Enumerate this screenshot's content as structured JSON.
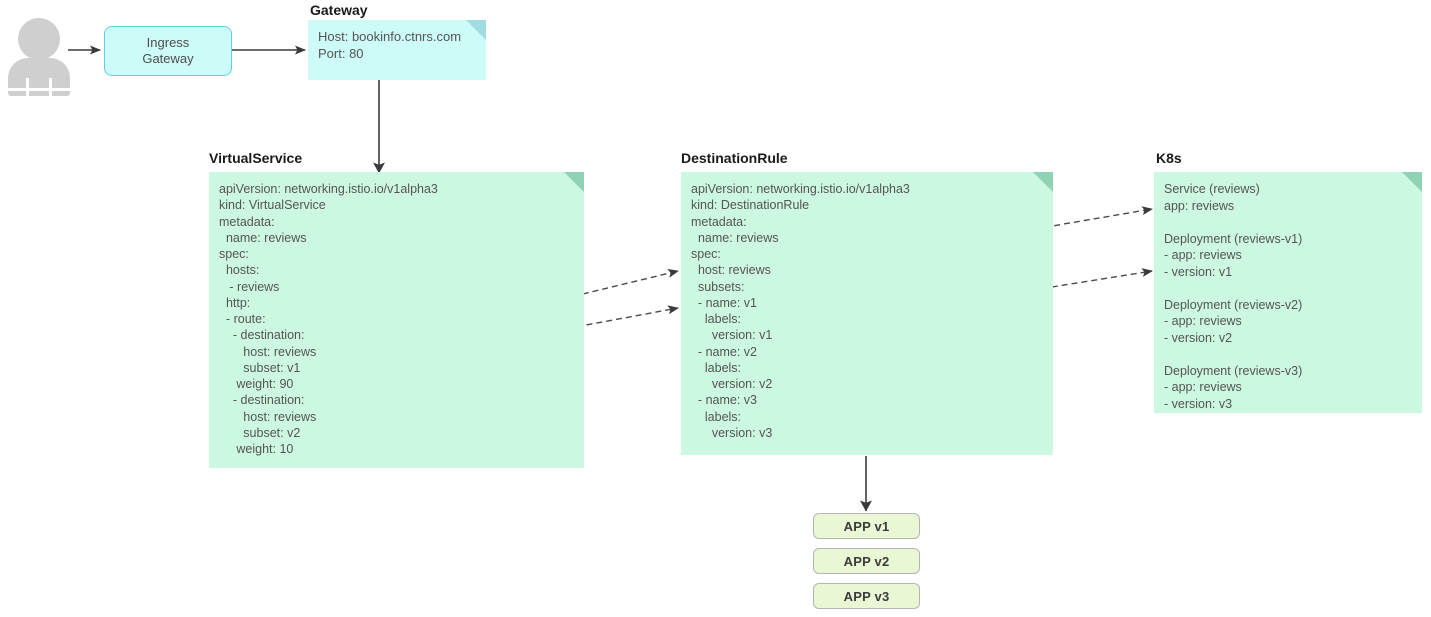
{
  "diagram": {
    "title": "Istio traffic routing for the reviews service",
    "colors": {
      "cyan_fill": "#ccfbf8",
      "cyan_border": "#5fd0d6",
      "cyan_fold": "#9fdde2",
      "green_fill": "#ccf7e0",
      "green_fold": "#8fd3b4",
      "chip_fill": "#e9f7d4",
      "chip_border": "#b5b5b5",
      "actor_gray": "#cfcfcf",
      "edge": "#3a3a3a",
      "text": "#555555",
      "title_text": "#1a1a1a"
    }
  },
  "actor": {
    "name": "user-actor"
  },
  "ingress": {
    "label": "Ingress\nGateway",
    "line1": "Ingress",
    "line2": "Gateway"
  },
  "gateway": {
    "title": "Gateway",
    "body": "Host: bookinfo.ctnrs.com\nPort: 80",
    "lines": [
      "Host: bookinfo.ctnrs.com",
      "Port: 80"
    ]
  },
  "virtualservice": {
    "title": "VirtualService",
    "body": "apiVersion: networking.istio.io/v1alpha3\nkind: VirtualService\nmetadata:\n  name: reviews\nspec:\n  hosts:\n   - reviews\n  http:\n  - route:\n    - destination:\n       host: reviews\n       subset: v1\n     weight: 90\n    - destination:\n       host: reviews\n       subset: v2\n     weight: 10",
    "lines": [
      "apiVersion: networking.istio.io/v1alpha3",
      "kind: VirtualService",
      "metadata:",
      "  name: reviews",
      "spec:",
      "  hosts:",
      "   - reviews",
      "  http:",
      "  - route:",
      "    - destination:",
      "       host: reviews",
      "       subset: v1",
      "     weight: 90",
      "    - destination:",
      "       host: reviews",
      "       subset: v2",
      "     weight: 10"
    ]
  },
  "destinationrule": {
    "title": "DestinationRule",
    "body": "apiVersion: networking.istio.io/v1alpha3\nkind: DestinationRule\nmetadata:\n  name: reviews\nspec:\n  host: reviews\n  subsets:\n  - name: v1\n    labels:\n      version: v1\n  - name: v2\n    labels:\n      version: v2\n  - name: v3\n    labels:\n      version: v3",
    "lines": [
      "apiVersion: networking.istio.io/v1alpha3",
      "kind: DestinationRule",
      "metadata:",
      "  name: reviews",
      "spec:",
      "  host: reviews",
      "  subsets:",
      "  - name: v1",
      "    labels:",
      "      version: v1",
      "  - name: v2",
      "    labels:",
      "      version: v2",
      "  - name: v3",
      "    labels:",
      "      version: v3"
    ]
  },
  "k8s": {
    "title": "K8s",
    "body": "Service (reviews)\napp: reviews\n\nDeployment (reviews-v1)\n- app: reviews\n- version: v1\n\nDeployment (reviews-v2)\n- app: reviews\n- version: v2\n\nDeployment (reviews-v3)\n- app: reviews\n- version: v3",
    "lines": [
      "Service (reviews)",
      "app: reviews",
      "",
      "Deployment (reviews-v1)",
      "- app: reviews",
      "- version: v1",
      "",
      "Deployment (reviews-v2)",
      "- app: reviews",
      "- version: v2",
      "",
      "Deployment (reviews-v3)",
      "- app: reviews",
      "- version: v3"
    ]
  },
  "apps": [
    {
      "label": "APP v1"
    },
    {
      "label": "APP v2"
    },
    {
      "label": "APP v3"
    }
  ]
}
